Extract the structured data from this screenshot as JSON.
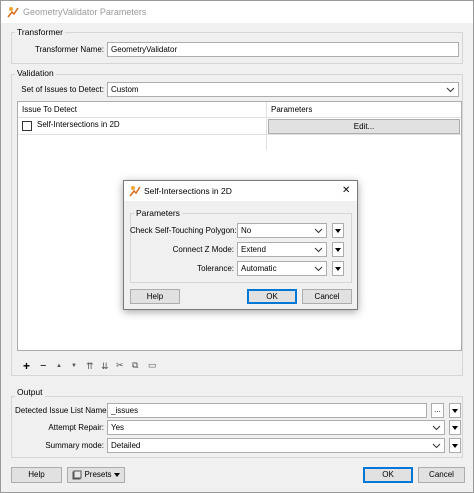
{
  "window": {
    "title": "GeometryValidator Parameters"
  },
  "transformer": {
    "group_label": "Transformer",
    "name_label": "Transformer Name:",
    "name_value": "GeometryValidator"
  },
  "validation": {
    "group_label": "Validation",
    "set_label": "Set of Issues to Detect:",
    "set_value": "Custom",
    "table": {
      "col_issue": "Issue To Detect",
      "col_params": "Parameters",
      "rows": [
        {
          "issue": "Self-Intersections in 2D",
          "button": "Edit..."
        }
      ]
    }
  },
  "toolbar": {
    "add": "+",
    "remove": "−",
    "up": "▲",
    "down": "▼",
    "top": "⇈",
    "bottom": "⇊",
    "cut": "✂",
    "copy": "⧉",
    "paste": "▭"
  },
  "output": {
    "group_label": "Output",
    "issue_list_label": "Detected Issue List Name:",
    "issue_list_value": "_issues",
    "ellipsis": "...",
    "repair_label": "Attempt Repair:",
    "repair_value": "Yes",
    "summary_label": "Summary mode:",
    "summary_value": "Detailed"
  },
  "footer": {
    "help": "Help",
    "presets": "Presets",
    "ok": "OK",
    "cancel": "Cancel"
  },
  "dialog": {
    "title": "Self-Intersections in 2D",
    "close": "✕",
    "group_label": "Parameters",
    "touching_label": "Check Self-Touching Polygon:",
    "touching_value": "No",
    "zmode_label": "Connect Z Mode:",
    "zmode_value": "Extend",
    "tolerance_label": "Tolerance:",
    "tolerance_value": "Automatic",
    "help": "Help",
    "ok": "OK",
    "cancel": "Cancel"
  },
  "colors": {
    "accent": "#0078d7",
    "window_bg": "#f0f0f0",
    "border": "#adadad"
  }
}
